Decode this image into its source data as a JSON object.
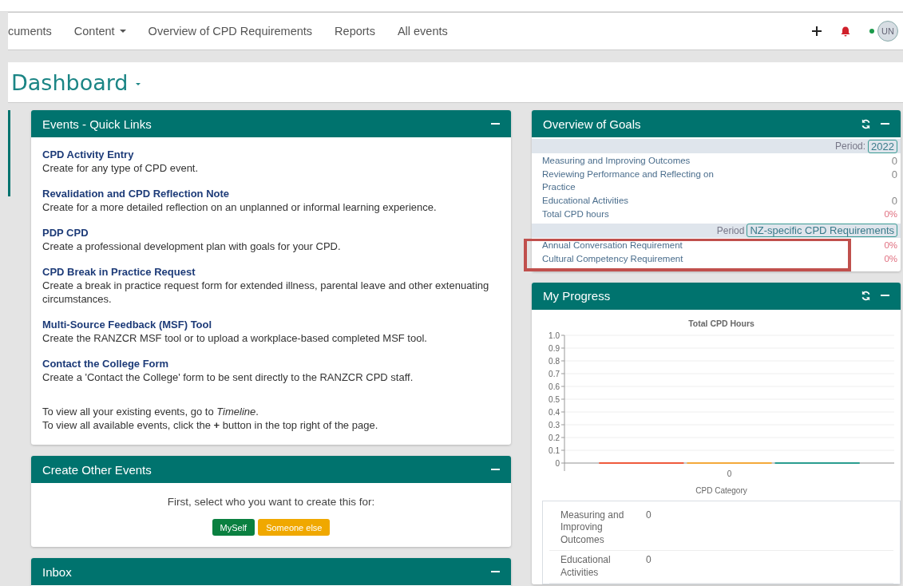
{
  "nav": {
    "items": [
      {
        "label": "cuments",
        "dropdown": false
      },
      {
        "label": "Content",
        "dropdown": true
      },
      {
        "label": "Overview of CPD Requirements",
        "dropdown": false
      },
      {
        "label": "Reports",
        "dropdown": false
      },
      {
        "label": "All events",
        "dropdown": false
      }
    ],
    "avatar": "UN",
    "online": true
  },
  "page_title": "Dashboard",
  "quick_links": {
    "title": "Events - Quick Links",
    "links": [
      {
        "title": "CPD Activity Entry",
        "description": "Create for any type of CPD event."
      },
      {
        "title": "Revalidation and CPD Reflection Note",
        "description": "Create for a more detailed reflection on an unplanned or informal learning experience."
      },
      {
        "title": "PDP CPD",
        "description": "Create a professional development plan with goals for your CPD."
      },
      {
        "title": "CPD Break in Practice Request",
        "description": "Create a break in practice request form for extended illness, parental leave and other extenuating circumstances."
      },
      {
        "title": "Multi-Source Feedback (MSF) Tool",
        "description": "Create the RANZCR MSF tool or to upload a workplace-based completed MSF tool."
      },
      {
        "title": "Contact the College Form",
        "description": "Create a 'Contact the College' form to be sent directly to the RANZCR CPD staff."
      }
    ],
    "notes": [
      "To view all your existing events, go to *Timeline*.",
      "To view all available events, click the **+** button in the top right of the page."
    ]
  },
  "create_other": {
    "title": "Create Other Events",
    "prompt": "First, select who you want to create this for:",
    "buttons": [
      {
        "label": "MySelf",
        "kind": "primary"
      },
      {
        "label": "Someone else",
        "kind": "warning"
      }
    ]
  },
  "inbox": {
    "title": "Inbox"
  },
  "goals": {
    "title": "Overview of Goals",
    "sections": [
      {
        "period_label": "Period:",
        "period": "2022",
        "rows": [
          {
            "label": "Measuring and Improving Outcomes",
            "value": "0",
            "kind": "count"
          },
          {
            "label": "Reviewing Performance and Reflecting on Practice",
            "value": "0",
            "kind": "count"
          },
          {
            "label": "Educational Activities",
            "value": "0",
            "kind": "count"
          },
          {
            "label": "Total CPD hours",
            "value": "0%",
            "kind": "percent"
          }
        ]
      },
      {
        "period_label": "Period",
        "period": "NZ-specific CPD Requirements",
        "rows": [
          {
            "label": "Annual Conversation Requirement",
            "value": "0%",
            "kind": "percent"
          },
          {
            "label": "Cultural Competency Requirement",
            "value": "0%",
            "kind": "percent"
          }
        ]
      }
    ]
  },
  "progress": {
    "title": "My Progress",
    "chart_data": {
      "type": "bar",
      "title": "Total CPD Hours",
      "xlabel": "CPD Category",
      "categories": [
        "0"
      ],
      "series": [
        {
          "color": "#ef5a3c",
          "values": [
            0
          ]
        },
        {
          "color": "#f4a93a",
          "values": [
            0
          ]
        },
        {
          "color": "#2a9d8f",
          "values": [
            0
          ]
        }
      ],
      "grid": true,
      "ylim": [
        0,
        1
      ],
      "yticks": [
        {
          "value": 0,
          "label": "0"
        },
        {
          "value": 0.1,
          "label": "0.1"
        },
        {
          "value": 0.2,
          "label": "0.2"
        },
        {
          "value": 0.3,
          "label": "0.3"
        },
        {
          "value": 0.4,
          "label": "0.4"
        },
        {
          "value": 0.5,
          "label": "0.5"
        },
        {
          "value": 0.6,
          "label": "0.6"
        },
        {
          "value": 0.7,
          "label": "0.7"
        },
        {
          "value": 0.8,
          "label": "0.8"
        },
        {
          "value": 0.9,
          "label": "0.9"
        },
        {
          "value": 1,
          "label": "1.0"
        }
      ]
    },
    "table": [
      {
        "category": "Measuring and Improving Outcomes",
        "hours": "0"
      },
      {
        "category": "Educational Activities",
        "hours": "0"
      }
    ]
  }
}
